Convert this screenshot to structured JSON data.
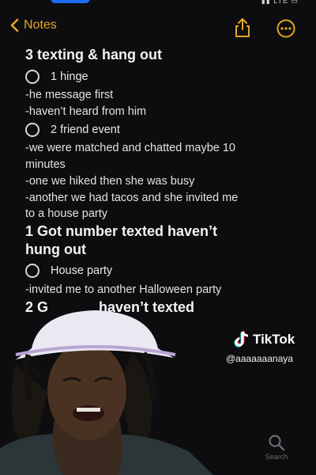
{
  "nav": {
    "back_label": "Notes"
  },
  "note": {
    "sections": [
      {
        "heading": "3 texting & hang out",
        "items": [
          {
            "label": "1 hinge",
            "lines": [
              "-he message first",
              "-haven’t heard from him"
            ]
          },
          {
            "label": "2 friend event",
            "lines": [
              "-we were matched and chatted maybe 10",
              "minutes",
              "-one we hiked then she was busy",
              "-another we had tacos and she invited me",
              "to a house party"
            ]
          }
        ]
      },
      {
        "heading_line1": "1 Got number texted haven’t",
        "heading_line2": "hung out",
        "items": [
          {
            "label": "House party",
            "lines": [
              "-invited me to another Halloween party"
            ]
          }
        ]
      },
      {
        "heading_prefix": "2 G",
        "heading_suffix": "haven’t texted"
      }
    ]
  },
  "overlay": {
    "brand": "TikTok",
    "handle": "@aaaaaaanaya"
  },
  "tabbar": {
    "search_label": "Search"
  },
  "colors": {
    "accent": "#e6a623",
    "background": "#0d0d0f"
  }
}
